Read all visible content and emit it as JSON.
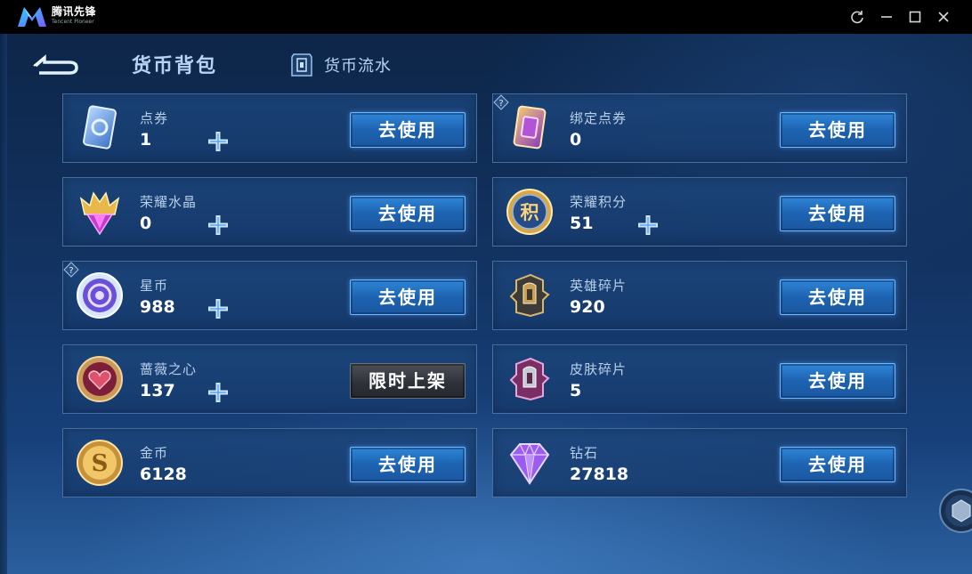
{
  "window": {
    "app_title": "腾讯先锋",
    "app_subtitle": "Tencent Pioneer",
    "controls": [
      "refresh-icon",
      "minimize-icon",
      "maximize-icon",
      "close-icon"
    ]
  },
  "header": {
    "active_tab": "货币背包",
    "flow_tab": "货币流水"
  },
  "currencies": [
    {
      "name": "点券",
      "value": "1",
      "action": "去使用",
      "plus": true,
      "icon": "voucher-card-icon"
    },
    {
      "name": "绑定点券",
      "value": "0",
      "action": "去使用",
      "plus": false,
      "icon": "bound-voucher-card-icon",
      "help": true
    },
    {
      "name": "荣耀水晶",
      "value": "0",
      "action": "去使用",
      "plus": true,
      "icon": "glory-crystal-icon"
    },
    {
      "name": "荣耀积分",
      "value": "51",
      "action": "去使用",
      "plus": true,
      "icon": "glory-points-icon"
    },
    {
      "name": "星币",
      "value": "988",
      "action": "去使用",
      "plus": true,
      "icon": "star-coin-icon",
      "help": true
    },
    {
      "name": "英雄碎片",
      "value": "920",
      "action": "去使用",
      "plus": false,
      "icon": "hero-fragment-icon"
    },
    {
      "name": "蔷薇之心",
      "value": "137",
      "action": "限时上架",
      "plus": true,
      "icon": "rose-heart-icon",
      "disabled_style": true
    },
    {
      "name": "皮肤碎片",
      "value": "5",
      "action": "去使用",
      "plus": false,
      "icon": "skin-fragment-icon"
    },
    {
      "name": "金币",
      "value": "6128",
      "action": "去使用",
      "plus": false,
      "icon": "gold-coin-icon"
    },
    {
      "name": "钻石",
      "value": "27818",
      "action": "去使用",
      "plus": false,
      "icon": "diamond-icon"
    }
  ],
  "colors": {
    "background": "#123260",
    "card": "#1c467c",
    "button": "#1d63b1",
    "button_border": "#6fb9ff",
    "label": "#b9cfe9"
  }
}
